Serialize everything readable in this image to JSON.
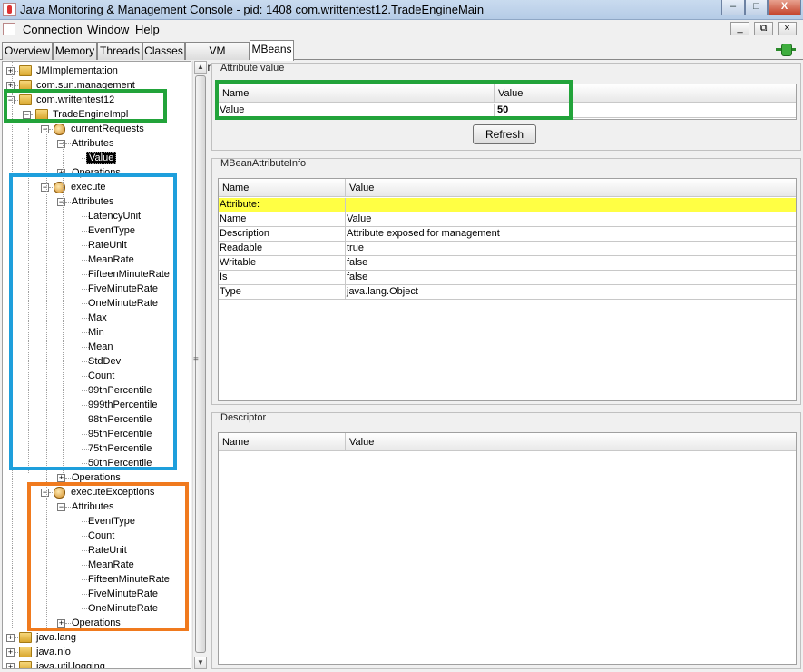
{
  "window": {
    "title": "Java Monitoring & Management Console - pid: 1408 com.writtentest12.TradeEngineMain",
    "buttons": {
      "minimize": "–",
      "maximize": "□",
      "close": "X"
    }
  },
  "menubar": {
    "items": [
      "Connection",
      "Window",
      "Help"
    ],
    "mdi": [
      "_",
      "⧉",
      "×"
    ]
  },
  "tabs": [
    "Overview",
    "Memory",
    "Threads",
    "Classes",
    "VM Summary",
    "MBeans"
  ],
  "active_tab": "MBeans",
  "tree": {
    "nodes": [
      {
        "label": "JMImplementation",
        "type": "folder"
      },
      {
        "label": "com.sun.management",
        "type": "folder"
      },
      {
        "label": "com.writtentest12",
        "type": "folder"
      },
      {
        "label": "TradeEngineImpl",
        "type": "folder"
      },
      {
        "label": "currentRequests",
        "type": "bean"
      },
      {
        "label": "Attributes"
      },
      {
        "label": "Value",
        "selected": true
      },
      {
        "label": "Operations"
      },
      {
        "label": "execute",
        "type": "bean"
      },
      {
        "label": "Attributes"
      },
      {
        "label": "LatencyUnit"
      },
      {
        "label": "EventType"
      },
      {
        "label": "RateUnit"
      },
      {
        "label": "MeanRate"
      },
      {
        "label": "FifteenMinuteRate"
      },
      {
        "label": "FiveMinuteRate"
      },
      {
        "label": "OneMinuteRate"
      },
      {
        "label": "Max"
      },
      {
        "label": "Min"
      },
      {
        "label": "Mean"
      },
      {
        "label": "StdDev"
      },
      {
        "label": "Count"
      },
      {
        "label": "99thPercentile"
      },
      {
        "label": "999thPercentile"
      },
      {
        "label": "98thPercentile"
      },
      {
        "label": "95thPercentile"
      },
      {
        "label": "75thPercentile"
      },
      {
        "label": "50thPercentile"
      },
      {
        "label": "Operations"
      },
      {
        "label": "executeExceptions",
        "type": "bean"
      },
      {
        "label": "Attributes"
      },
      {
        "label": "EventType"
      },
      {
        "label": "Count"
      },
      {
        "label": "RateUnit"
      },
      {
        "label": "MeanRate"
      },
      {
        "label": "FifteenMinuteRate"
      },
      {
        "label": "FiveMinuteRate"
      },
      {
        "label": "OneMinuteRate"
      },
      {
        "label": "Operations"
      },
      {
        "label": "java.lang",
        "type": "folder"
      },
      {
        "label": "java.nio",
        "type": "folder"
      },
      {
        "label": "java.util.logging",
        "type": "folder"
      }
    ]
  },
  "attribute_value": {
    "title": "Attribute value",
    "columns": [
      "Name",
      "Value"
    ],
    "rows": [
      {
        "name": "Value",
        "value": "50"
      }
    ],
    "refresh_label": "Refresh"
  },
  "attribute_info": {
    "title": "MBeanAttributeInfo",
    "columns": [
      "Name",
      "Value"
    ],
    "rows": [
      {
        "name": "Attribute:",
        "value": ""
      },
      {
        "name": "Name",
        "value": "Value"
      },
      {
        "name": "Description",
        "value": "Attribute exposed for management"
      },
      {
        "name": "Readable",
        "value": "true"
      },
      {
        "name": "Writable",
        "value": "false"
      },
      {
        "name": "Is",
        "value": "false"
      },
      {
        "name": "Type",
        "value": "java.lang.Object"
      }
    ]
  },
  "descriptor": {
    "title": "Descriptor",
    "columns": [
      "Name",
      "Value"
    ]
  },
  "colors": {
    "highlight_green": "#22a33a",
    "highlight_blue": "#1e9fdc",
    "highlight_orange": "#f07a1e",
    "attribute_header_row": "#ffff44"
  }
}
